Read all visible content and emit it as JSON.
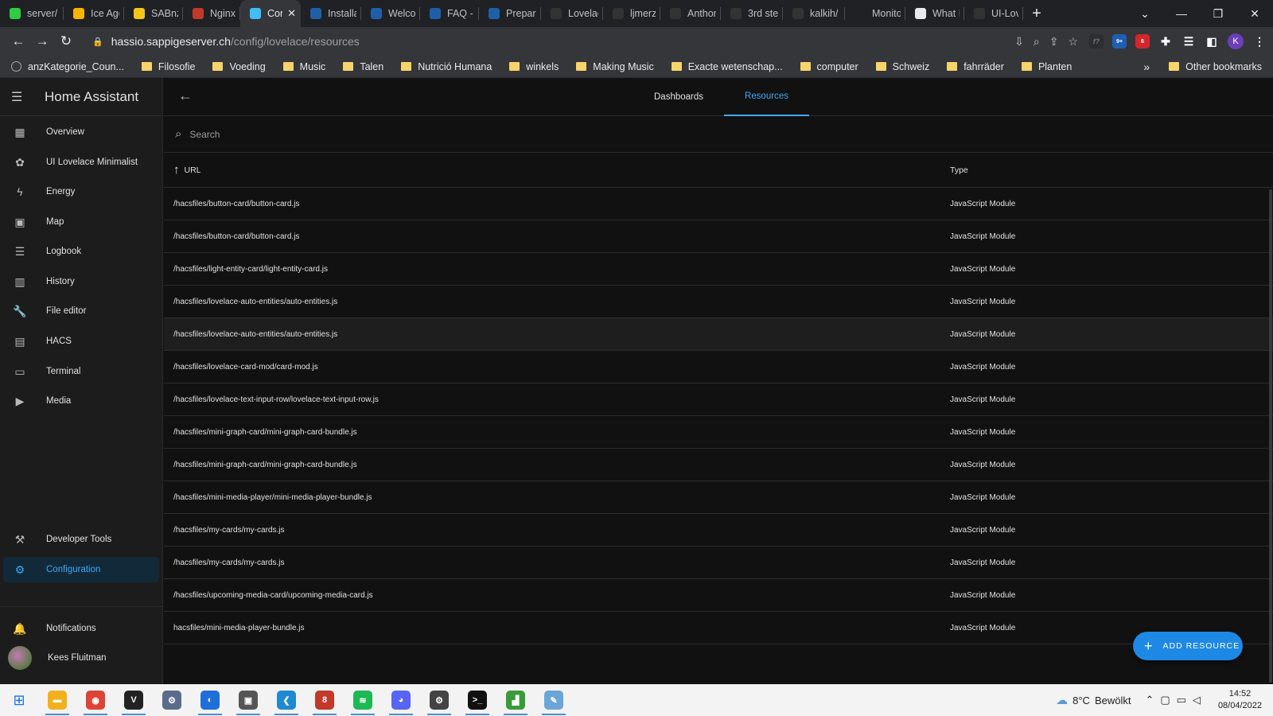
{
  "browser": {
    "tabs": [
      {
        "title": "server/",
        "color": "#2ecc40",
        "active": false
      },
      {
        "title": "Ice Age",
        "color": "#f7b500",
        "active": false
      },
      {
        "title": "SABnzbd",
        "color": "#f5c518",
        "active": false
      },
      {
        "title": "Nginx P",
        "color": "#c0392b",
        "active": false
      },
      {
        "title": "Con",
        "color": "#41bdf5",
        "active": true
      },
      {
        "title": "Installa",
        "color": "#1f5fa8",
        "active": false
      },
      {
        "title": "Welcon",
        "color": "#1f5fa8",
        "active": false
      },
      {
        "title": "FAQ - U",
        "color": "#1f5fa8",
        "active": false
      },
      {
        "title": "Prepare",
        "color": "#1f5fa8",
        "active": false
      },
      {
        "title": "Lovelac",
        "color": "#333333",
        "active": false
      },
      {
        "title": "ljmerza",
        "color": "#333333",
        "active": false
      },
      {
        "title": "Anthor",
        "color": "#333333",
        "active": false
      },
      {
        "title": "3rd step",
        "color": "#333333",
        "active": false
      },
      {
        "title": "kalkih/",
        "color": "#333333",
        "active": false
      },
      {
        "title": "Monito",
        "color": "#202124",
        "active": false
      },
      {
        "title": "What I",
        "color": "#e8eaed",
        "active": false
      },
      {
        "title": "UI-Lov",
        "color": "#333333",
        "active": false
      }
    ],
    "url_host": "hassio.sappigeserver.ch",
    "url_path": "/config/lovelace/resources",
    "extension_badges": [
      "9+",
      "6"
    ],
    "profile_initial": "K",
    "bookmarks": [
      {
        "label": "anzKategorie_Coun...",
        "type": "globe"
      },
      {
        "label": "Filosofie",
        "type": "folder"
      },
      {
        "label": "Voeding",
        "type": "folder"
      },
      {
        "label": "Music",
        "type": "folder"
      },
      {
        "label": "Talen",
        "type": "folder"
      },
      {
        "label": "Nutrició Humana",
        "type": "folder"
      },
      {
        "label": "winkels",
        "type": "folder"
      },
      {
        "label": "Making Music",
        "type": "folder"
      },
      {
        "label": "Exacte wetenschap...",
        "type": "folder"
      },
      {
        "label": "computer",
        "type": "folder"
      },
      {
        "label": "Schweiz",
        "type": "folder"
      },
      {
        "label": "fahrräder",
        "type": "folder"
      },
      {
        "label": "Planten",
        "type": "folder"
      }
    ],
    "other_bookmarks": "Other bookmarks",
    "bookmarks_more": "»"
  },
  "sidebar": {
    "title": "Home Assistant",
    "items": [
      {
        "label": "Overview",
        "icon": "view-dashboard-icon",
        "glyph": "▦"
      },
      {
        "label": "UI Lovelace Minimalist",
        "icon": "flower-icon",
        "glyph": "✿"
      },
      {
        "label": "Energy",
        "icon": "lightning-icon",
        "glyph": "ϟ"
      },
      {
        "label": "Map",
        "icon": "account-box-icon",
        "glyph": "▣"
      },
      {
        "label": "Logbook",
        "icon": "format-list-icon",
        "glyph": "☰"
      },
      {
        "label": "History",
        "icon": "chart-box-icon",
        "glyph": "▥"
      },
      {
        "label": "File editor",
        "icon": "wrench-icon",
        "glyph": "🔧"
      },
      {
        "label": "HACS",
        "icon": "hacs-icon",
        "glyph": "▤"
      },
      {
        "label": "Terminal",
        "icon": "console-icon",
        "glyph": "▭"
      },
      {
        "label": "Media",
        "icon": "play-box-icon",
        "glyph": "▶"
      }
    ],
    "developer_tools": "Developer Tools",
    "configuration": "Configuration",
    "notifications": "Notifications",
    "user_name": "Kees Fluitman"
  },
  "main": {
    "tabs": [
      "Dashboards",
      "Resources"
    ],
    "active_tab": "Resources",
    "search_placeholder": "Search",
    "columns": {
      "url": "URL",
      "type": "Type"
    },
    "rows": [
      {
        "url": "/hacsfiles/button-card/button-card.js",
        "type": "JavaScript Module"
      },
      {
        "url": "/hacsfiles/button-card/button-card.js",
        "type": "JavaScript Module"
      },
      {
        "url": "/hacsfiles/light-entity-card/light-entity-card.js",
        "type": "JavaScript Module"
      },
      {
        "url": "/hacsfiles/lovelace-auto-entities/auto-entities.js",
        "type": "JavaScript Module"
      },
      {
        "url": "/hacsfiles/lovelace-auto-entities/auto-entities.js",
        "type": "JavaScript Module"
      },
      {
        "url": "/hacsfiles/lovelace-card-mod/card-mod.js",
        "type": "JavaScript Module"
      },
      {
        "url": "/hacsfiles/lovelace-text-input-row/lovelace-text-input-row.js",
        "type": "JavaScript Module"
      },
      {
        "url": "/hacsfiles/mini-graph-card/mini-graph-card-bundle.js",
        "type": "JavaScript Module"
      },
      {
        "url": "/hacsfiles/mini-graph-card/mini-graph-card-bundle.js",
        "type": "JavaScript Module"
      },
      {
        "url": "/hacsfiles/mini-media-player/mini-media-player-bundle.js",
        "type": "JavaScript Module"
      },
      {
        "url": "/hacsfiles/my-cards/my-cards.js",
        "type": "JavaScript Module"
      },
      {
        "url": "/hacsfiles/my-cards/my-cards.js",
        "type": "JavaScript Module"
      },
      {
        "url": "/hacsfiles/upcoming-media-card/upcoming-media-card.js",
        "type": "JavaScript Module"
      },
      {
        "url": "hacsfiles/mini-media-player-bundle.js",
        "type": "JavaScript Module"
      }
    ],
    "add_button": "ADD RESOURCE"
  },
  "taskbar": {
    "apps": [
      {
        "name": "file-explorer-icon",
        "color": "#f2b01e",
        "glyph": "▬",
        "open": true
      },
      {
        "name": "chrome-icon",
        "color": "#db4437",
        "glyph": "◉",
        "open": true
      },
      {
        "name": "vnc-viewer-icon",
        "color": "#222222",
        "glyph": "V",
        "open": true
      },
      {
        "name": "network-app-icon",
        "color": "#5a6b8c",
        "glyph": "⚙",
        "open": false
      },
      {
        "name": "remote-app-icon",
        "color": "#1e6fd9",
        "glyph": "◐",
        "open": true
      },
      {
        "name": "system-app-icon",
        "color": "#555555",
        "glyph": "▣",
        "open": true
      },
      {
        "name": "vscode-icon",
        "color": "#1f8ad2",
        "glyph": "❮",
        "open": true
      },
      {
        "name": "app-8-icon",
        "color": "#c0392b",
        "glyph": "8",
        "open": true
      },
      {
        "name": "spotify-icon",
        "color": "#1db954",
        "glyph": "≋",
        "open": true
      },
      {
        "name": "discord-icon",
        "color": "#5865f2",
        "glyph": "◕",
        "open": true
      },
      {
        "name": "settings-icon",
        "color": "#444444",
        "glyph": "⚙",
        "open": true
      },
      {
        "name": "terminal-icon",
        "color": "#111111",
        "glyph": ">_",
        "open": true
      },
      {
        "name": "task-manager-icon",
        "color": "#3a9b3a",
        "glyph": "▟",
        "open": true
      },
      {
        "name": "paint-icon",
        "color": "#6aa6d8",
        "glyph": "✎",
        "open": true
      }
    ],
    "weather_temp": "8°C",
    "weather_desc": "Bewölkt",
    "time": "14:52",
    "date": "08/04/2022"
  }
}
